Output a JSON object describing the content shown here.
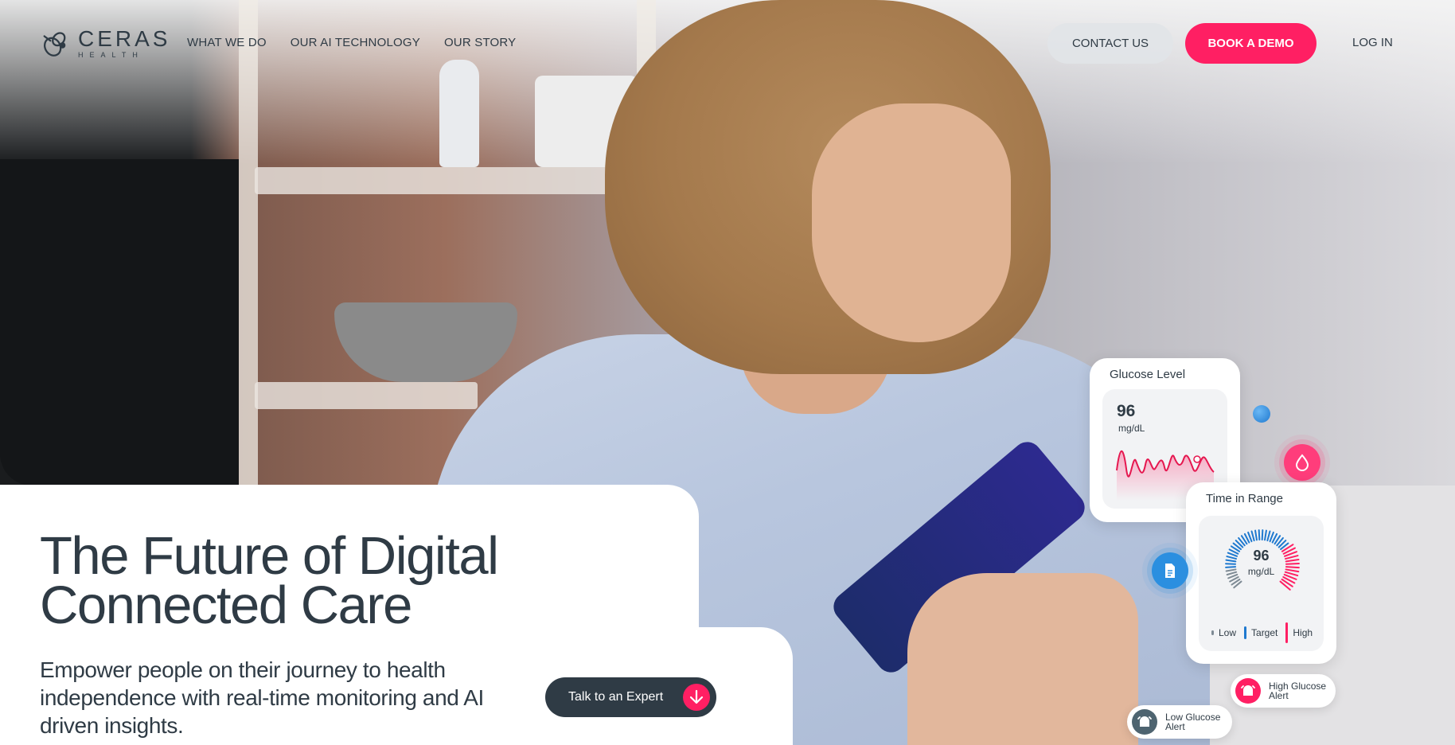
{
  "brand": {
    "name": "CERAS",
    "sub": "HEALTH"
  },
  "nav": {
    "items": [
      {
        "label": "WHAT WE DO"
      },
      {
        "label": "OUR AI TECHNOLOGY"
      },
      {
        "label": "OUR STORY"
      }
    ],
    "contact_label": "CONTACT US",
    "demo_label": "BOOK A DEMO",
    "login_label": "LOG IN"
  },
  "hero": {
    "headline": "The Future of Digital Connected Care",
    "subtext": "Empower people on their journey to health independence with real-time monitoring and AI driven insights.",
    "cta_label": "Talk to an Expert"
  },
  "glucose_card": {
    "title": "Glucose Level",
    "value": "96",
    "unit": "mg/dL"
  },
  "tir_card": {
    "title": "Time in Range",
    "value": "96",
    "unit": "mg/dL",
    "legend": [
      {
        "label": "Low",
        "color": "#7e8a94"
      },
      {
        "label": "Target",
        "color": "#1f79cf"
      },
      {
        "label": "High",
        "color": "#ff1f63"
      }
    ]
  },
  "alerts": {
    "high": "High Glucose Alert",
    "low": "Low Glucose Alert"
  },
  "colors": {
    "accent": "#ff1f63",
    "dark": "#2f3b45",
    "blue": "#1f79cf"
  },
  "icons": [
    "bee-logo-icon",
    "arrow-down-icon",
    "blood-drop-icon",
    "document-icon",
    "alarm-bell-icon"
  ]
}
